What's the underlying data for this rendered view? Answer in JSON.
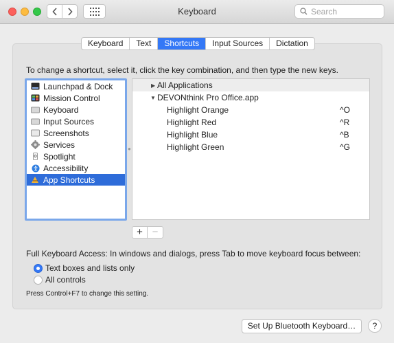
{
  "window": {
    "title": "Keyboard"
  },
  "toolbar": {
    "back_icon": "chevron-left-icon",
    "forward_icon": "chevron-right-icon",
    "grid_icon": "grid-icon",
    "search_placeholder": "Search"
  },
  "tabs": [
    {
      "label": "Keyboard",
      "active": false
    },
    {
      "label": "Text",
      "active": false
    },
    {
      "label": "Shortcuts",
      "active": true
    },
    {
      "label": "Input Sources",
      "active": false
    },
    {
      "label": "Dictation",
      "active": false
    }
  ],
  "instructions": "To change a shortcut, select it, click the key combination, and then type the new keys.",
  "sidebar": {
    "items": [
      {
        "label": "Launchpad & Dock",
        "icon": "launchpad-icon"
      },
      {
        "label": "Mission Control",
        "icon": "mission-control-icon"
      },
      {
        "label": "Keyboard",
        "icon": "keyboard-icon"
      },
      {
        "label": "Input Sources",
        "icon": "input-sources-icon"
      },
      {
        "label": "Screenshots",
        "icon": "screenshot-icon"
      },
      {
        "label": "Services",
        "icon": "gear-icon"
      },
      {
        "label": "Spotlight",
        "icon": "spotlight-icon"
      },
      {
        "label": "Accessibility",
        "icon": "accessibility-icon"
      },
      {
        "label": "App Shortcuts",
        "icon": "app-shortcuts-icon",
        "selected": true
      }
    ]
  },
  "shortcuts": {
    "groups": [
      {
        "label": "All Applications",
        "expanded": false
      },
      {
        "label": "DEVONthink Pro Office.app",
        "expanded": true,
        "items": [
          {
            "label": "Highlight Orange",
            "key": "^O"
          },
          {
            "label": "Highlight Red",
            "key": "^R"
          },
          {
            "label": "Highlight Blue",
            "key": "^B"
          },
          {
            "label": "Highlight Green",
            "key": "^G"
          }
        ]
      }
    ],
    "add_label": "+",
    "remove_label": "−"
  },
  "keyboard_access": {
    "label": "Full Keyboard Access: In windows and dialogs, press Tab to move keyboard focus between:",
    "options": [
      {
        "label": "Text boxes and lists only",
        "selected": true
      },
      {
        "label": "All controls",
        "selected": false
      }
    ],
    "note": "Press Control+F7 to change this setting."
  },
  "footer": {
    "bluetooth_button": "Set Up Bluetooth Keyboard…",
    "help_button": "?"
  },
  "colors": {
    "accent": "#3478f6",
    "selection": "#2e6cd9",
    "focus_ring": "#7aa7ea"
  }
}
